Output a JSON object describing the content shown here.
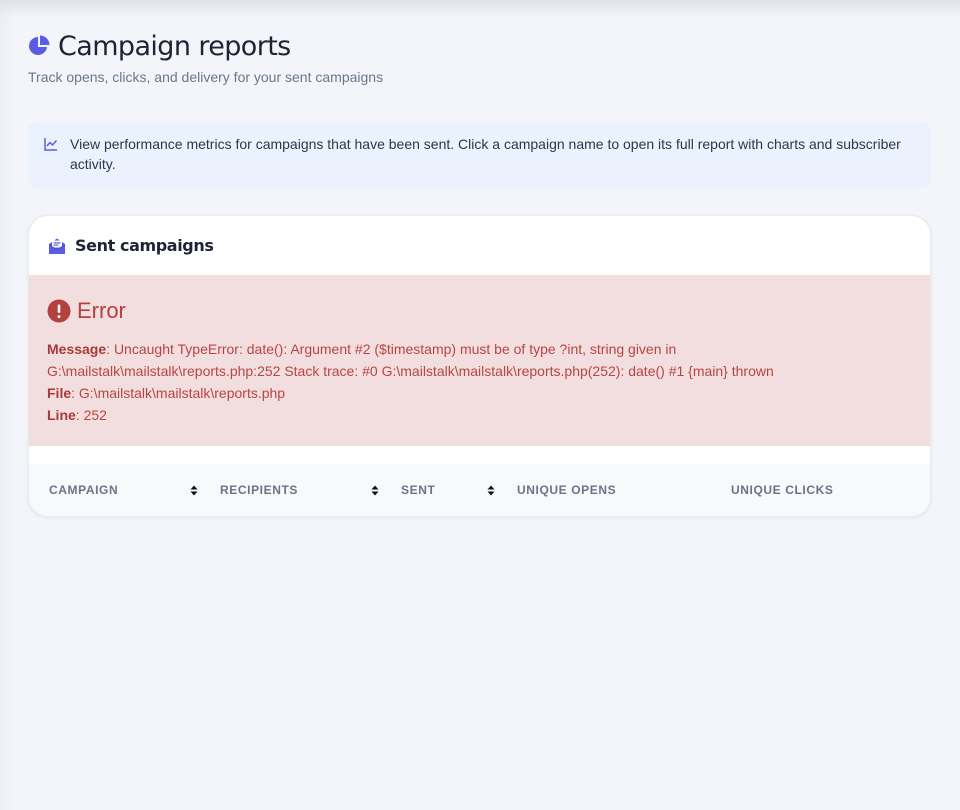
{
  "header": {
    "title": "Campaign reports",
    "subtitle": "Track opens, clicks, and delivery for your sent campaigns"
  },
  "info": {
    "text": "View performance metrics for campaigns that have been sent. Click a campaign name to open its full report with charts and subscriber activity."
  },
  "card": {
    "title": "Sent campaigns",
    "error": {
      "title": "Error",
      "message_label": "Message",
      "message": "Uncaught TypeError: date(): Argument #2 ($timestamp) must be of type ?int, string given in G:\\mailstalk\\mailstalk\\reports.php:252 Stack trace: #0 G:\\mailstalk\\mailstalk\\reports.php(252): date() #1 {main} thrown",
      "file_label": "File",
      "file": "G:\\mailstalk\\mailstalk\\reports.php",
      "line_label": "Line",
      "line": "252"
    },
    "table": {
      "columns": [
        "CAMPAIGN",
        "RECIPIENTS",
        "SENT",
        "UNIQUE OPENS",
        "UNIQUE CLICKS"
      ]
    }
  },
  "icons": {
    "title": "pie-chart-icon",
    "info": "line-chart-icon",
    "card": "envelope-open-icon",
    "error": "exclamation-circle-icon",
    "sort": "sort-icon"
  },
  "colors": {
    "accent": "#5b5ce6",
    "background": "#f3f5fa",
    "info_bg": "#ecf2fd",
    "error_bg": "#f2dede",
    "error_text": "#b84544",
    "table_head_bg": "#f7f9fb"
  }
}
